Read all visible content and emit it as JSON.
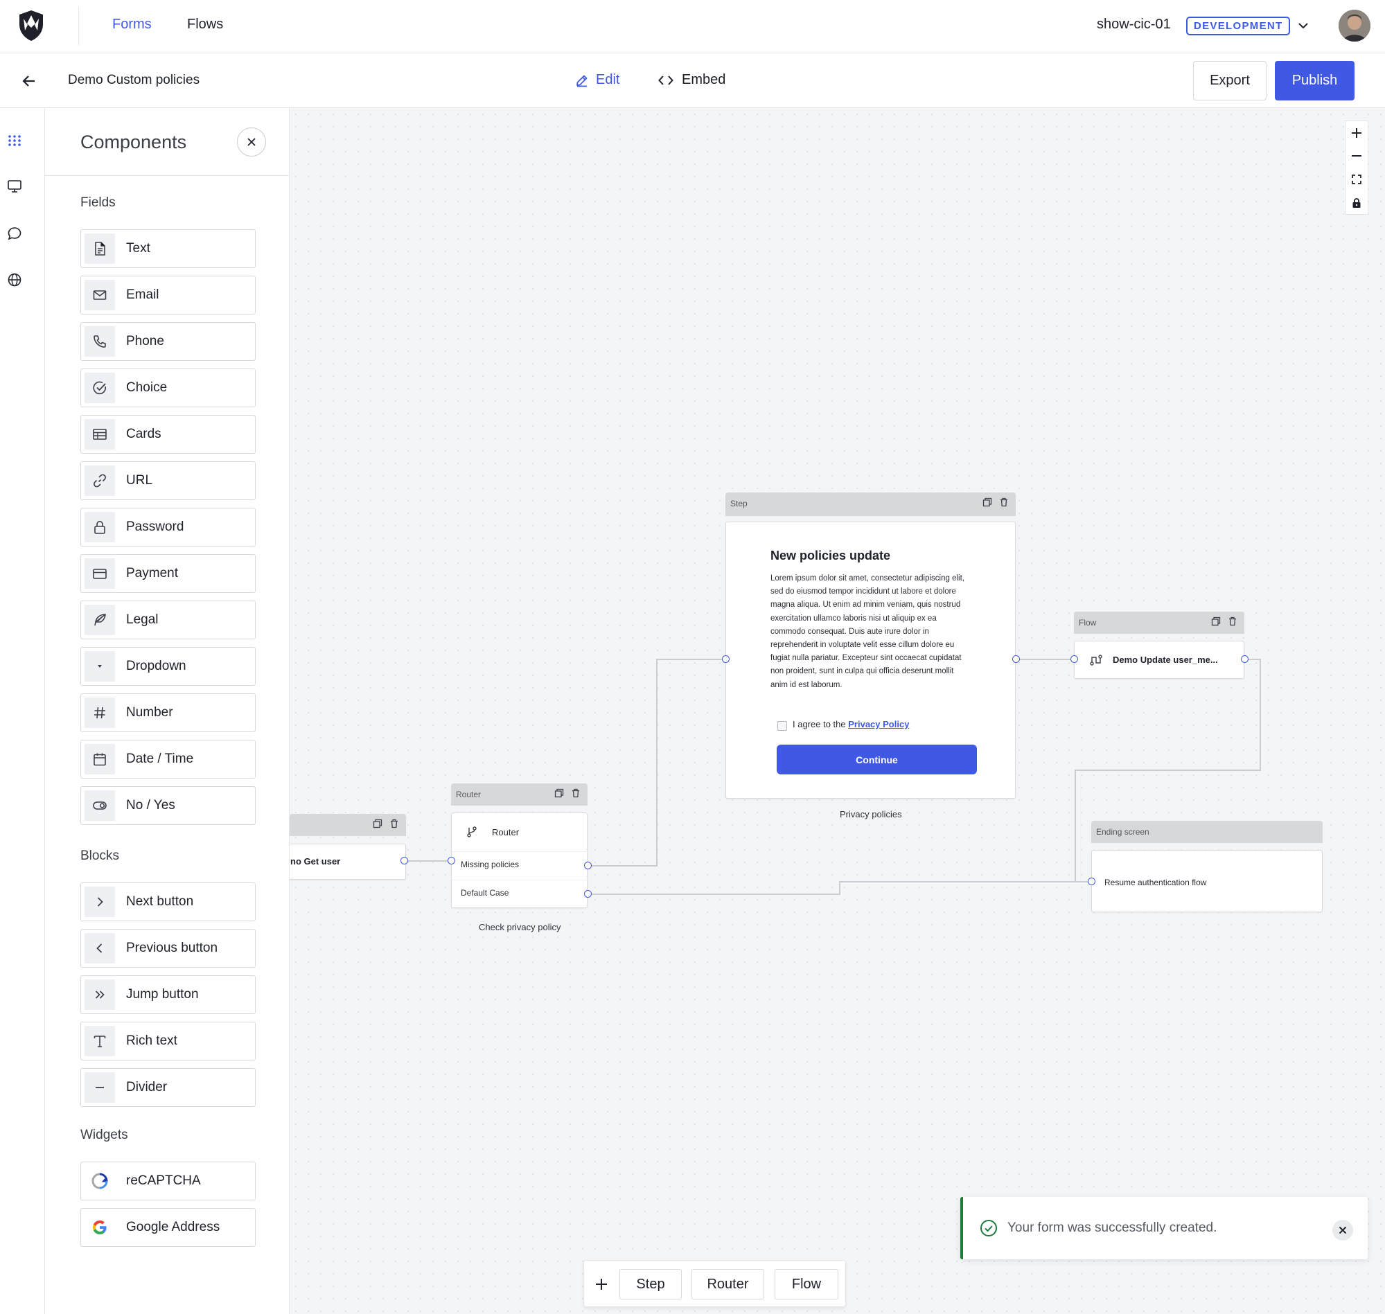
{
  "header": {
    "nav": [
      {
        "label": "Forms",
        "active": true
      },
      {
        "label": "Flows",
        "active": false
      }
    ],
    "tenant": "show-cic-01",
    "environment_badge": "DEVELOPMENT"
  },
  "toolbar": {
    "form_name": "Demo Custom policies",
    "edit_label": "Edit",
    "embed_label": "Embed",
    "export_label": "Export",
    "publish_label": "Publish"
  },
  "panel": {
    "title": "Components",
    "sections": {
      "fields": "Fields",
      "blocks": "Blocks",
      "widgets": "Widgets"
    },
    "fields": [
      "Text",
      "Email",
      "Phone",
      "Choice",
      "Cards",
      "URL",
      "Password",
      "Payment",
      "Legal",
      "Dropdown",
      "Number",
      "Date / Time",
      "No / Yes"
    ],
    "blocks": [
      "Next button",
      "Previous button",
      "Jump button",
      "Rich text",
      "Divider"
    ],
    "widgets": [
      "reCAPTCHA",
      "Google Address"
    ]
  },
  "canvas": {
    "partial_node": {
      "label": "no Get user"
    },
    "router_node": {
      "header": "Router",
      "title": "Router",
      "rows": [
        "Missing policies",
        "Default Case"
      ],
      "caption": "Check privacy policy"
    },
    "step_node": {
      "header": "Step",
      "heading": "New policies update",
      "body": "Lorem ipsum dolor sit amet, consectetur adipiscing elit, sed do eiusmod tempor incididunt ut labore et dolore magna aliqua. Ut enim ad minim veniam, quis nostrud exercitation ullamco laboris nisi ut aliquip ex ea commodo consequat. Duis aute irure dolor in reprehenderit in voluptate velit esse cillum dolore eu fugiat nulla pariatur. Excepteur sint occaecat cupidatat non proident, sunt in culpa qui officia deserunt mollit anim id est laborum.",
      "agree_prefix": "I agree to the",
      "agree_link": "Privacy Policy",
      "button": "Continue",
      "caption": "Privacy policies"
    },
    "flow_node": {
      "header": "Flow",
      "label": "Demo Update user_me..."
    },
    "ending_node": {
      "header": "Ending screen",
      "label": "Resume authentication flow"
    }
  },
  "bottom_toolbar": {
    "buttons": [
      "Step",
      "Router",
      "Flow"
    ]
  },
  "toast": {
    "message": "Your form was successfully created."
  },
  "colors": {
    "accent": "#3f59e4",
    "success": "#1d7c3a"
  }
}
